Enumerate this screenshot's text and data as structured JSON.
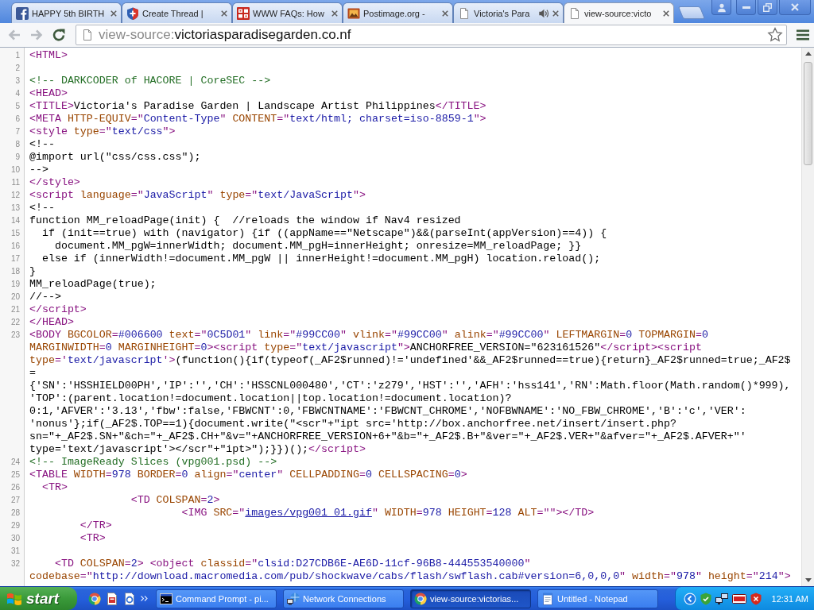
{
  "tabs": [
    {
      "title": "HAPPY 5th BIRTH",
      "kind": "social",
      "selected": false,
      "audio": false
    },
    {
      "title": "Create Thread |",
      "kind": "shield",
      "selected": false,
      "audio": false
    },
    {
      "title": "WWW FAQs: How",
      "kind": "tile",
      "selected": false,
      "audio": false
    },
    {
      "title": "Postimage.org -",
      "kind": "photo",
      "selected": false,
      "audio": false
    },
    {
      "title": "Victoria's Para",
      "kind": "page",
      "selected": false,
      "audio": true
    },
    {
      "title": "view-source:victo",
      "kind": "page",
      "selected": true,
      "audio": false
    }
  ],
  "toolbar": {
    "back": {
      "disabled": true
    },
    "forward": {
      "disabled": true
    },
    "address": {
      "scheme": "view-source:",
      "host": "victoriasparadisegarden.co.nf"
    }
  },
  "source": {
    "lines": [
      {
        "number": "1",
        "segments": [
          {
            "tokens": [
              {
                "kind": "tag",
                "text": "<HTML>"
              }
            ]
          }
        ]
      },
      {
        "number": "2"
      },
      {
        "number": "3",
        "segments": [
          {
            "tokens": [
              {
                "kind": "comment",
                "text": "<!-- DARKCODER of HACORE | CoreSEC -->"
              }
            ]
          }
        ]
      },
      {
        "number": "4",
        "segments": [
          {
            "tokens": [
              {
                "kind": "tag",
                "text": "<HEAD>"
              }
            ]
          }
        ]
      },
      {
        "number": "5",
        "segments": [
          {
            "tokens": [
              {
                "kind": "tag",
                "text": "<TITLE>"
              },
              {
                "kind": "text",
                "text": "Victoria's Paradise Garden | Landscape Artist Philippines"
              },
              {
                "kind": "tag",
                "text": "</TITLE>"
              }
            ]
          }
        ]
      },
      {
        "number": "6",
        "segments": [
          {
            "tokens": [
              {
                "kind": "tag",
                "text": "<META "
              },
              {
                "kind": "attr",
                "text": "HTTP-EQUIV"
              },
              {
                "kind": "tag",
                "text": "=\""
              },
              {
                "kind": "value",
                "text": "Content-Type"
              },
              {
                "kind": "tag",
                "text": "\" "
              },
              {
                "kind": "attr",
                "text": "CONTENT"
              },
              {
                "kind": "tag",
                "text": "=\""
              },
              {
                "kind": "value",
                "text": "text/html; charset=iso-8859-1"
              },
              {
                "kind": "tag",
                "text": "\">"
              }
            ]
          }
        ]
      },
      {
        "number": "7",
        "segments": [
          {
            "tokens": [
              {
                "kind": "tag",
                "text": "<style "
              },
              {
                "kind": "attr",
                "text": "type"
              },
              {
                "kind": "tag",
                "text": "=\""
              },
              {
                "kind": "value",
                "text": "text/css"
              },
              {
                "kind": "tag",
                "text": "\">"
              }
            ]
          }
        ]
      },
      {
        "number": "8",
        "segments": [
          {
            "tokens": [
              {
                "kind": "text",
                "text": "<!--"
              }
            ]
          }
        ]
      },
      {
        "number": "9",
        "segments": [
          {
            "tokens": [
              {
                "kind": "text",
                "text": "@import url(\"css/css.css\");"
              }
            ]
          }
        ]
      },
      {
        "number": "10",
        "segments": [
          {
            "tokens": [
              {
                "kind": "text",
                "text": "-->"
              }
            ]
          }
        ]
      },
      {
        "number": "11",
        "segments": [
          {
            "tokens": [
              {
                "kind": "tag",
                "text": "</style>"
              }
            ]
          }
        ]
      },
      {
        "number": "12",
        "segments": [
          {
            "tokens": [
              {
                "kind": "tag",
                "text": "<script "
              },
              {
                "kind": "attr",
                "text": "language"
              },
              {
                "kind": "tag",
                "text": "=\""
              },
              {
                "kind": "value",
                "text": "JavaScript"
              },
              {
                "kind": "tag",
                "text": "\" "
              },
              {
                "kind": "attr",
                "text": "type"
              },
              {
                "kind": "tag",
                "text": "=\""
              },
              {
                "kind": "value",
                "text": "text/JavaScript"
              },
              {
                "kind": "tag",
                "text": "\">"
              }
            ]
          }
        ]
      },
      {
        "number": "13",
        "segments": [
          {
            "tokens": [
              {
                "kind": "text",
                "text": "<!--"
              }
            ]
          }
        ]
      },
      {
        "number": "14",
        "segments": [
          {
            "tokens": [
              {
                "kind": "text",
                "text": "function MM_reloadPage(init) {  //reloads the window if Nav4 resized"
              }
            ]
          }
        ]
      },
      {
        "number": "15",
        "segments": [
          {
            "tokens": [
              {
                "kind": "text",
                "text": "  if (init==true) with (navigator) {if ((appName==\"Netscape\")&&(parseInt(appVersion)==4)) {"
              }
            ]
          }
        ]
      },
      {
        "number": "16",
        "segments": [
          {
            "tokens": [
              {
                "kind": "text",
                "text": "    document.MM_pgW=innerWidth; document.MM_pgH=innerHeight; onresize=MM_reloadPage; }}"
              }
            ]
          }
        ]
      },
      {
        "number": "17",
        "segments": [
          {
            "tokens": [
              {
                "kind": "text",
                "text": "  else if (innerWidth!=document.MM_pgW || innerHeight!=document.MM_pgH) location.reload();"
              }
            ]
          }
        ]
      },
      {
        "number": "18",
        "segments": [
          {
            "tokens": [
              {
                "kind": "text",
                "text": "}"
              }
            ]
          }
        ]
      },
      {
        "number": "19",
        "segments": [
          {
            "tokens": [
              {
                "kind": "text",
                "text": "MM_reloadPage(true);"
              }
            ]
          }
        ]
      },
      {
        "number": "20",
        "segments": [
          {
            "tokens": [
              {
                "kind": "text",
                "text": "//-->"
              }
            ]
          }
        ]
      },
      {
        "number": "21",
        "segments": [
          {
            "tokens": [
              {
                "kind": "tag",
                "text": "</script>"
              }
            ]
          }
        ]
      },
      {
        "number": "22",
        "segments": [
          {
            "tokens": [
              {
                "kind": "tag",
                "text": "</HEAD>"
              }
            ]
          }
        ]
      },
      {
        "number": "23",
        "segments": [
          {
            "tokens": [
              {
                "kind": "tag",
                "text": "<BODY "
              },
              {
                "kind": "attr",
                "text": "BGCOLOR"
              },
              {
                "kind": "tag",
                "text": "="
              },
              {
                "kind": "value",
                "text": "#006600"
              },
              {
                "kind": "attr",
                "text": " text"
              },
              {
                "kind": "tag",
                "text": "=\""
              },
              {
                "kind": "value",
                "text": "0C5D01"
              },
              {
                "kind": "tag",
                "text": "\" "
              },
              {
                "kind": "attr",
                "text": "link"
              },
              {
                "kind": "tag",
                "text": "=\""
              },
              {
                "kind": "value",
                "text": "#99CC00"
              },
              {
                "kind": "tag",
                "text": "\" "
              },
              {
                "kind": "attr",
                "text": "vlink"
              },
              {
                "kind": "tag",
                "text": "=\""
              },
              {
                "kind": "value",
                "text": "#99CC00"
              },
              {
                "kind": "tag",
                "text": "\" "
              },
              {
                "kind": "attr",
                "text": "alink"
              },
              {
                "kind": "tag",
                "text": "=\""
              },
              {
                "kind": "value",
                "text": "#99CC00"
              },
              {
                "kind": "tag",
                "text": "\" "
              },
              {
                "kind": "attr",
                "text": "LEFTMARGIN"
              },
              {
                "kind": "tag",
                "text": "="
              },
              {
                "kind": "value",
                "text": "0"
              },
              {
                "kind": "attr",
                "text": " TOPMARGIN"
              },
              {
                "kind": "tag",
                "text": "="
              },
              {
                "kind": "value",
                "text": "0"
              }
            ]
          },
          {
            "tokens": [
              {
                "kind": "attr",
                "text": "MARGINWIDTH"
              },
              {
                "kind": "tag",
                "text": "="
              },
              {
                "kind": "value",
                "text": "0"
              },
              {
                "kind": "attr",
                "text": " MARGINHEIGHT"
              },
              {
                "kind": "tag",
                "text": "="
              },
              {
                "kind": "value",
                "text": "0"
              },
              {
                "kind": "tag",
                "text": "><script "
              },
              {
                "kind": "attr",
                "text": "type"
              },
              {
                "kind": "tag",
                "text": "=\""
              },
              {
                "kind": "value",
                "text": "text/javascript"
              },
              {
                "kind": "tag",
                "text": "\">"
              },
              {
                "kind": "text",
                "text": "ANCHORFREE_VERSION=\"623161526\""
              },
              {
                "kind": "tag",
                "text": "</script><script"
              }
            ]
          },
          {
            "tokens": [
              {
                "kind": "attr",
                "text": "type"
              },
              {
                "kind": "tag",
                "text": "='"
              },
              {
                "kind": "value",
                "text": "text/javascript"
              },
              {
                "kind": "tag",
                "text": "'>"
              },
              {
                "kind": "text",
                "text": "(function(){if(typeof(_AF2$runned)!='undefined'&&_AF2$runned==true){return}_AF2$runned=true;_AF2$"
              }
            ]
          },
          {
            "tokens": [
              {
                "kind": "text",
                "text": "="
              }
            ]
          },
          {
            "tokens": [
              {
                "kind": "text",
                "text": "{'SN':'HSSHIELD00PH','IP':'','CH':'HSSCNL000480','CT':'z279','HST':'','AFH':'hss141','RN':Math.floor(Math.random()*999),"
              }
            ]
          },
          {
            "tokens": [
              {
                "kind": "text",
                "text": "'TOP':(parent.location!=document.location||top.location!=document.location)?"
              }
            ]
          },
          {
            "tokens": [
              {
                "kind": "text",
                "text": "0:1,'AFVER':'3.13','fbw':false,'FBWCNT':0,'FBWCNTNAME':'FBWCNT_CHROME','NOFBWNAME':'NO_FBW_CHROME','B':'c','VER':"
              }
            ]
          },
          {
            "tokens": [
              {
                "kind": "text",
                "text": "'nonus'};if(_AF2$.TOP==1){document.write(\"<scr\"+\"ipt src='http://box.anchorfree.net/insert/insert.php?"
              }
            ]
          },
          {
            "tokens": [
              {
                "kind": "text",
                "text": "sn=\"+_AF2$.SN+\"&ch=\"+_AF2$.CH+\"&v=\"+ANCHORFREE_VERSION+6+\"&b=\"+_AF2$.B+\"&ver=\"+_AF2$.VER+\"&afver=\"+_AF2$.AFVER+\"'"
              }
            ]
          },
          {
            "tokens": [
              {
                "kind": "text",
                "text": "type='text/javascript'></scr\"+\"ipt>\");}})();"
              },
              {
                "kind": "tag",
                "text": "</script>"
              }
            ]
          }
        ]
      },
      {
        "number": "24",
        "segments": [
          {
            "tokens": [
              {
                "kind": "comment",
                "text": "<!-- ImageReady Slices (vpg001.psd) -->"
              }
            ]
          }
        ]
      },
      {
        "number": "25",
        "segments": [
          {
            "tokens": [
              {
                "kind": "tag",
                "text": "<TABLE "
              },
              {
                "kind": "attr",
                "text": "WIDTH"
              },
              {
                "kind": "tag",
                "text": "="
              },
              {
                "kind": "value",
                "text": "978"
              },
              {
                "kind": "attr",
                "text": " BORDER"
              },
              {
                "kind": "tag",
                "text": "="
              },
              {
                "kind": "value",
                "text": "0"
              },
              {
                "kind": "attr",
                "text": " align"
              },
              {
                "kind": "tag",
                "text": "=\""
              },
              {
                "kind": "value",
                "text": "center"
              },
              {
                "kind": "tag",
                "text": "\" "
              },
              {
                "kind": "attr",
                "text": "CELLPADDING"
              },
              {
                "kind": "tag",
                "text": "="
              },
              {
                "kind": "value",
                "text": "0"
              },
              {
                "kind": "attr",
                "text": " CELLSPACING"
              },
              {
                "kind": "tag",
                "text": "="
              },
              {
                "kind": "value",
                "text": "0"
              },
              {
                "kind": "tag",
                "text": ">"
              }
            ]
          }
        ]
      },
      {
        "number": "26",
        "segments": [
          {
            "tokens": [
              {
                "kind": "tag",
                "text": "  <TR>"
              }
            ]
          }
        ]
      },
      {
        "number": "27",
        "segments": [
          {
            "tokens": [
              {
                "kind": "tag",
                "text": "                <TD "
              },
              {
                "kind": "attr",
                "text": "COLSPAN"
              },
              {
                "kind": "tag",
                "text": "="
              },
              {
                "kind": "value",
                "text": "2"
              },
              {
                "kind": "tag",
                "text": ">"
              }
            ]
          }
        ]
      },
      {
        "number": "28",
        "segments": [
          {
            "tokens": [
              {
                "kind": "tag",
                "text": "                        <IMG "
              },
              {
                "kind": "attr",
                "text": "SRC"
              },
              {
                "kind": "tag",
                "text": "=\""
              },
              {
                "kind": "link",
                "text": "images/vpg001_01.gif"
              },
              {
                "kind": "tag",
                "text": "\" "
              },
              {
                "kind": "attr",
                "text": "WIDTH"
              },
              {
                "kind": "tag",
                "text": "="
              },
              {
                "kind": "value",
                "text": "978"
              },
              {
                "kind": "attr",
                "text": " HEIGHT"
              },
              {
                "kind": "tag",
                "text": "="
              },
              {
                "kind": "value",
                "text": "128"
              },
              {
                "kind": "attr",
                "text": " ALT"
              },
              {
                "kind": "tag",
                "text": "=\"\"></TD>"
              }
            ]
          }
        ]
      },
      {
        "number": "29",
        "segments": [
          {
            "tokens": [
              {
                "kind": "tag",
                "text": "        </TR>"
              }
            ]
          }
        ]
      },
      {
        "number": "30",
        "segments": [
          {
            "tokens": [
              {
                "kind": "tag",
                "text": "        <TR>"
              }
            ]
          }
        ]
      },
      {
        "number": "31"
      },
      {
        "number": "32",
        "segments": [
          {
            "tokens": [
              {
                "kind": "tag",
                "text": "    <TD "
              },
              {
                "kind": "attr",
                "text": "COLSPAN"
              },
              {
                "kind": "tag",
                "text": "="
              },
              {
                "kind": "value",
                "text": "2"
              },
              {
                "kind": "tag",
                "text": "> <object "
              },
              {
                "kind": "attr",
                "text": "classid"
              },
              {
                "kind": "tag",
                "text": "=\""
              },
              {
                "kind": "value",
                "text": "clsid:D27CDB6E-AE6D-11cf-96B8-444553540000"
              },
              {
                "kind": "tag",
                "text": "\""
              }
            ]
          },
          {
            "tokens": [
              {
                "kind": "attr",
                "text": "codebase"
              },
              {
                "kind": "tag",
                "text": "=\""
              },
              {
                "kind": "value",
                "text": "http://download.macromedia.com/pub/shockwave/cabs/flash/swflash.cab#version=6,0,0,0"
              },
              {
                "kind": "tag",
                "text": "\" "
              },
              {
                "kind": "attr",
                "text": "width"
              },
              {
                "kind": "tag",
                "text": "=\""
              },
              {
                "kind": "value",
                "text": "978"
              },
              {
                "kind": "tag",
                "text": "\" "
              },
              {
                "kind": "attr",
                "text": "height"
              },
              {
                "kind": "tag",
                "text": "=\""
              },
              {
                "kind": "value",
                "text": "214"
              },
              {
                "kind": "tag",
                "text": "\">"
              }
            ]
          }
        ]
      }
    ]
  },
  "taskbar": {
    "start": "start",
    "tasks": [
      {
        "label": "Command Prompt - pi...",
        "kind": "console",
        "selected": false
      },
      {
        "label": "Network Connections",
        "kind": "network",
        "selected": false
      },
      {
        "label": "view-source:victorias...",
        "kind": "browser",
        "selected": true
      },
      {
        "label": "Untitled - Notepad",
        "kind": "notepad",
        "selected": false
      }
    ],
    "clock": "12:31 AM"
  }
}
